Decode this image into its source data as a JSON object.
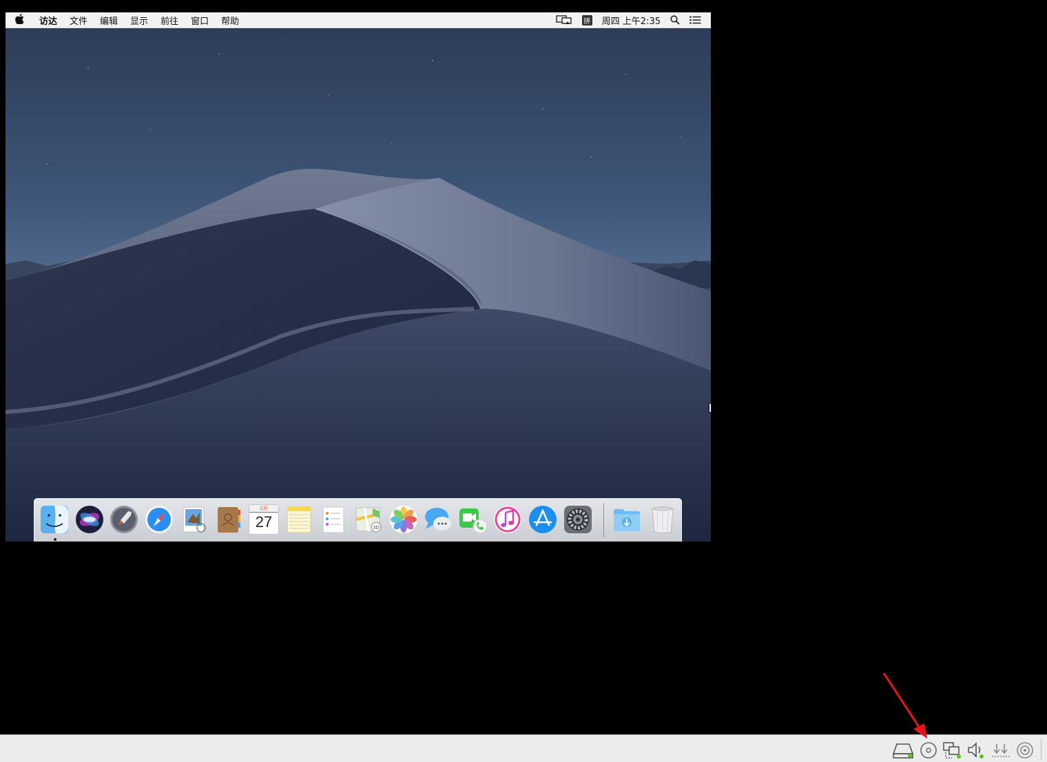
{
  "menubar": {
    "apple_glyph": "",
    "menus": [
      "访达",
      "文件",
      "编辑",
      "显示",
      "前往",
      "窗口",
      "帮助"
    ],
    "ime_label": "拼",
    "clock": "周四 上午2:35"
  },
  "dock": {
    "calendar_month": "2月",
    "calendar_day": "27",
    "apps": [
      "finder",
      "siri",
      "launchpad",
      "safari",
      "mail",
      "contacts",
      "calendar",
      "notes",
      "reminders",
      "maps",
      "photos",
      "messages",
      "facetime",
      "itunes",
      "app-store",
      "system-preferences",
      "downloads",
      "trash"
    ]
  },
  "statusbar": {
    "icons": [
      "hard-disk-icon",
      "optical-drive-icon",
      "network-icon",
      "audio-icon",
      "usb-icon",
      "recording-icon"
    ]
  },
  "colors": {
    "menubar": "#f2f2f2",
    "statusbar": "#ececec",
    "arrow": "#e8141b",
    "led": "#5cc41e"
  }
}
